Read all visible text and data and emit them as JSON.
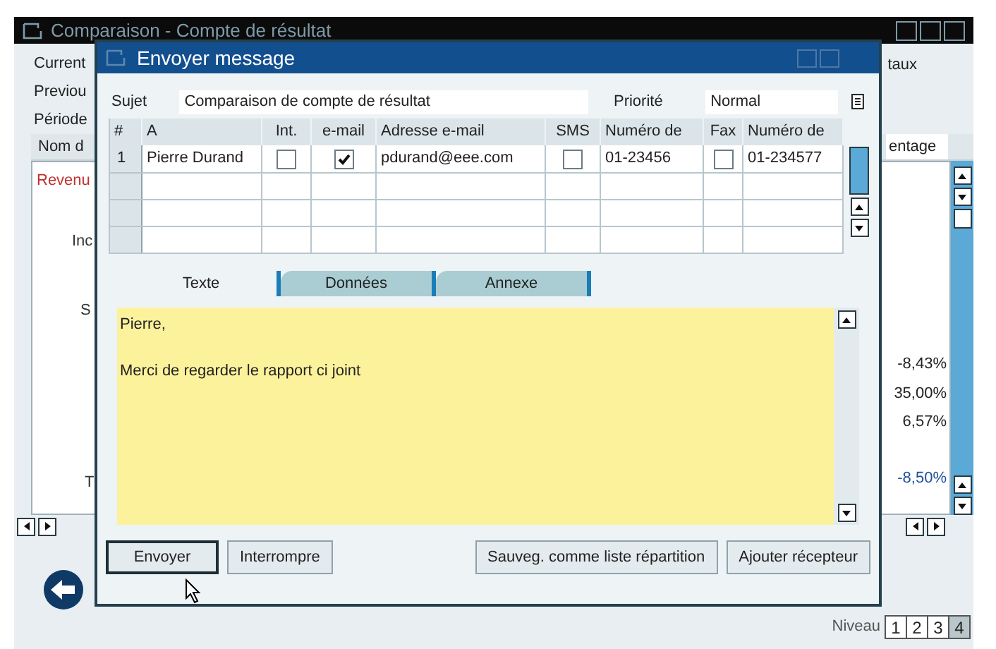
{
  "main_window": {
    "title": "Comparaison - Compte de résultat",
    "labels": [
      "Current",
      "Previou",
      "Période"
    ],
    "right_label": "taux",
    "table": {
      "column_1": "Nom d",
      "column_last": "entage",
      "left_texts": [
        {
          "text": "Revenu",
          "color": "#c0302a"
        },
        {
          "text": "Inc",
          "color": "#333333"
        },
        {
          "text": "S",
          "color": "#333333"
        },
        {
          "text": "T",
          "color": "#333333"
        }
      ],
      "values": [
        {
          "text": "-8,43%",
          "color": "#222222"
        },
        {
          "text": "35,00%",
          "color": "#222222"
        },
        {
          "text": "6,57%",
          "color": "#222222"
        },
        {
          "text": "-8,50%",
          "color": "#1f4f9a"
        }
      ]
    },
    "level_label": "Niveau",
    "levels": [
      {
        "label": "1",
        "selected": false
      },
      {
        "label": "2",
        "selected": false
      },
      {
        "label": "3",
        "selected": false
      },
      {
        "label": "4",
        "selected": true
      }
    ]
  },
  "dialog": {
    "title": "Envoyer message",
    "subject_label": "Sujet",
    "subject": "Comparaison de compte de résultat",
    "priority_label": "Priorité",
    "priority": "Normal",
    "grid": {
      "columns": [
        "#",
        "A",
        "Int.",
        "e-mail",
        "Adresse e-mail",
        "SMS",
        "Numéro de",
        "Fax",
        "Numéro de"
      ],
      "rows": [
        {
          "number": "1",
          "to": "Pierre Durand",
          "internal": false,
          "email": true,
          "address": "pdurand@eee.com",
          "sms": false,
          "sms_number": "01-23456",
          "fax": false,
          "fax_number": "01-234577"
        }
      ]
    },
    "tabs": [
      {
        "label": "Texte",
        "selected": true
      },
      {
        "label": "Données",
        "selected": false
      },
      {
        "label": "Annexe",
        "selected": false
      }
    ],
    "message": [
      "Pierre,",
      "Merci de regarder le rapport ci joint"
    ],
    "buttons_left": [
      {
        "label": "Envoyer",
        "focused": true
      },
      {
        "label": "Interrompre",
        "focused": false
      }
    ],
    "buttons_right": [
      {
        "label": "Sauveg. comme liste répartition",
        "focused": false
      },
      {
        "label": "Ajouter récepteur",
        "focused": false
      }
    ]
  }
}
